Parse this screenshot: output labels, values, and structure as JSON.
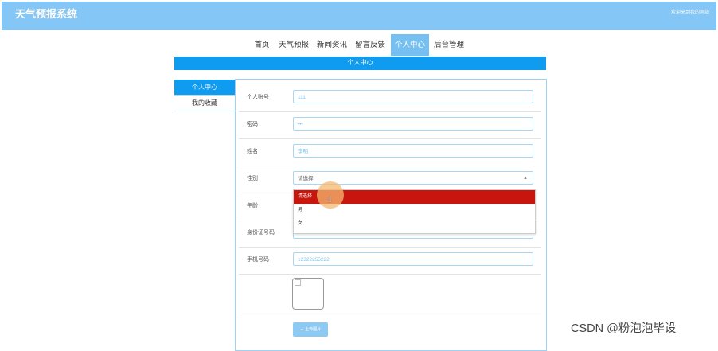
{
  "header": {
    "site_title": "天气预报系统",
    "welcome": "欢迎来到我的网站"
  },
  "nav": [
    {
      "label": "首页",
      "active": false
    },
    {
      "label": "天气预报",
      "active": false
    },
    {
      "label": "新闻资讯",
      "active": false
    },
    {
      "label": "留言反馈",
      "active": false
    },
    {
      "label": "个人中心",
      "active": true
    },
    {
      "label": "后台管理",
      "active": false
    }
  ],
  "section_title": "个人中心",
  "sidebar": [
    {
      "label": "个人中心",
      "active": true
    },
    {
      "label": "我的收藏",
      "active": false
    }
  ],
  "form": {
    "account": {
      "label": "个人账号",
      "value": "111"
    },
    "password": {
      "label": "密码",
      "value": "•••"
    },
    "name": {
      "label": "姓名",
      "value": "李明"
    },
    "gender": {
      "label": "性别",
      "value": "请选择",
      "options": [
        "请选择",
        "男",
        "女"
      ]
    },
    "age": {
      "label": "年龄",
      "value": ""
    },
    "id_card": {
      "label": "身份证号码",
      "value": "·····································"
    },
    "phone": {
      "label": "手机号码",
      "value": "12322255222"
    },
    "upload_label": "上传图片"
  },
  "watermark": "CSDN @粉泡泡毕设",
  "colors": {
    "header_bg": "#84c6f5",
    "accent": "#0e9bf0",
    "selected_option": "#c8150d"
  },
  "icons": {
    "cursor": "hand-pointer-icon",
    "upload": "cloud-upload-icon",
    "broken_image": "broken-image-icon"
  }
}
